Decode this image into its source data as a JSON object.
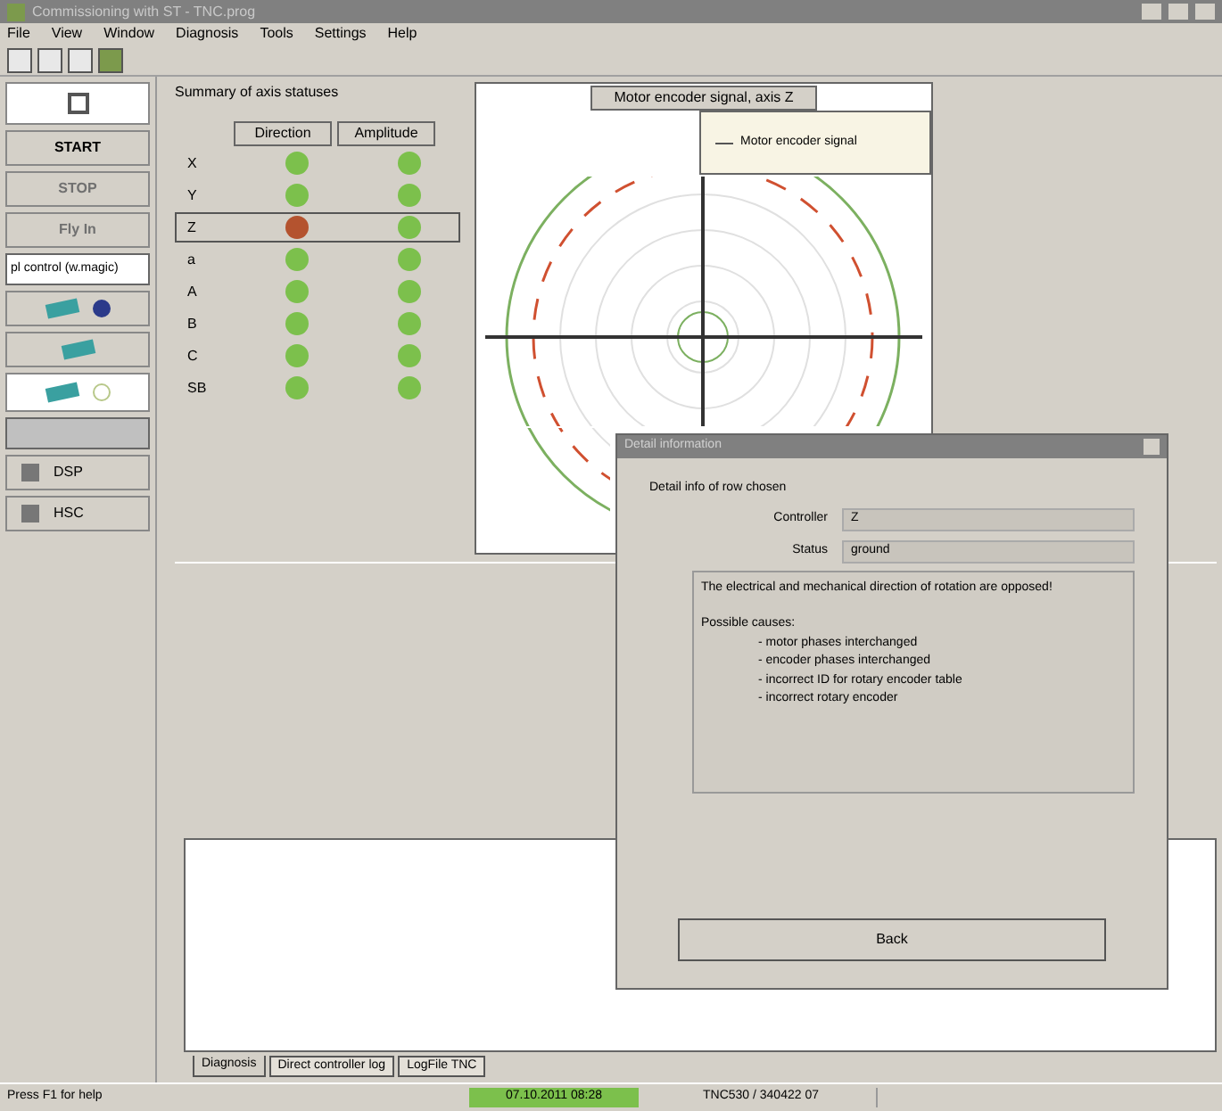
{
  "window": {
    "title": "Commissioning with ST - TNC.prog"
  },
  "menu": [
    "File",
    "View",
    "Window",
    "Diagnosis",
    "Tools",
    "Settings",
    "Help"
  ],
  "sidebar": {
    "buttons": [
      {
        "label": "START",
        "disabled": false
      },
      {
        "label": "STOP",
        "disabled": true
      },
      {
        "label": "Fly In",
        "disabled": true
      }
    ],
    "field_value": "pl control (w.magic)",
    "tools": [
      {
        "label": "DSP"
      },
      {
        "label": "HSC"
      }
    ]
  },
  "status_table": {
    "title": "Summary of axis statuses",
    "columns": [
      "Direction",
      "Amplitude"
    ],
    "rows": [
      {
        "axis": "X",
        "selected": false,
        "direction": {
          "color": "#7cc04c"
        },
        "amplitude": {
          "color": "#7cc04c"
        }
      },
      {
        "axis": "Y",
        "selected": false,
        "direction": {
          "color": "#7cc04c"
        },
        "amplitude": {
          "color": "#7cc04c"
        }
      },
      {
        "axis": "Z",
        "selected": true,
        "direction": {
          "color": "#b4532f"
        },
        "amplitude": {
          "color": "#7cc04c"
        }
      },
      {
        "axis": "a",
        "selected": false,
        "direction": {
          "color": "#7cc04c"
        },
        "amplitude": {
          "color": "#7cc04c"
        }
      },
      {
        "axis": "A",
        "selected": false,
        "direction": {
          "color": "#7cc04c"
        },
        "amplitude": {
          "color": "#7cc04c"
        }
      },
      {
        "axis": "B",
        "selected": false,
        "direction": {
          "color": "#7cc04c"
        },
        "amplitude": {
          "color": "#7cc04c"
        }
      },
      {
        "axis": "C",
        "selected": false,
        "direction": {
          "color": "#7cc04c"
        },
        "amplitude": {
          "color": "#7cc04c"
        }
      },
      {
        "axis": "SB",
        "selected": false,
        "direction": {
          "color": "#7cc04c"
        },
        "amplitude": {
          "color": "#7cc04c"
        }
      }
    ]
  },
  "chart": {
    "title": "Motor encoder signal, axis Z",
    "legend": "Motor encoder signal"
  },
  "dialog": {
    "title": "Detail information",
    "group": "Detail info of row chosen",
    "fields": [
      {
        "label": "Controller",
        "value": "Z"
      },
      {
        "label": "Status",
        "value": "ground"
      }
    ],
    "message": "The electrical and mechanical direction of rotation are opposed!",
    "causes_title": "Possible causes:",
    "causes": [
      "- motor phases interchanged",
      "- encoder phases interchanged",
      "- incorrect ID for rotary encoder table",
      "- incorrect rotary encoder"
    ],
    "button": "Back"
  },
  "tabs": [
    {
      "label": "Diagnosis",
      "selected": true
    },
    {
      "label": "Direct controller log",
      "selected": false
    },
    {
      "label": "LogFile TNC",
      "selected": false
    }
  ],
  "status_bar": {
    "help": "Press F1 for help",
    "time": "07.10.2011 08:28",
    "control": "TNC530 / 340422 07"
  }
}
